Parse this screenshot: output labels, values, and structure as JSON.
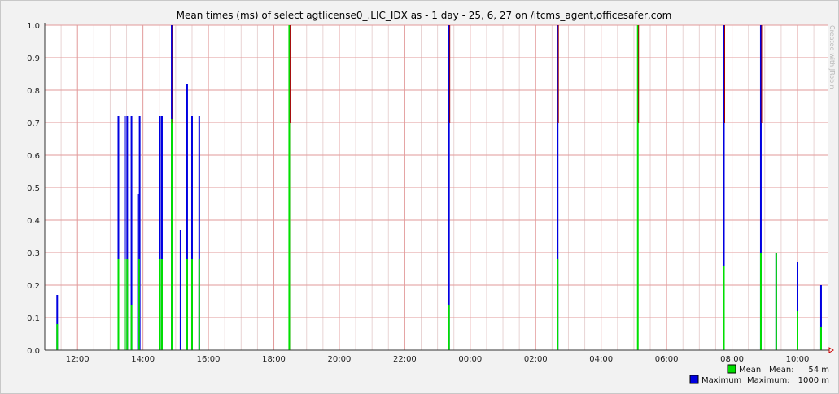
{
  "chart_data": {
    "type": "bar",
    "title": "Mean times (ms) of select agtlicense0_.LIC_IDX as - 1 day - 25, 6, 27 on /itcms_agent,officesafer,com",
    "watermark": "Created with JRobin",
    "x_ticks": [
      "12:00",
      "14:00",
      "16:00",
      "18:00",
      "20:00",
      "22:00",
      "00:00",
      "02:00",
      "04:00",
      "06:00",
      "08:00",
      "10:00"
    ],
    "x_range_hours": [
      11.0,
      22.6
    ],
    "x_tick_start_hour": 12,
    "y_ticks": [
      "0.0",
      "0.1",
      "0.2",
      "0.3",
      "0.4",
      "0.5",
      "0.6",
      "0.7",
      "0.8",
      "0.9",
      "1.0"
    ],
    "ylim": [
      0,
      1.0
    ],
    "grid": true,
    "series": [
      {
        "name": "Mean",
        "color": "#00e000",
        "stat_label": "Mean:",
        "stat_value": "54 m",
        "points": [
          {
            "h": 11.38,
            "v": 0.08
          },
          {
            "h": 13.25,
            "v": 0.28
          },
          {
            "h": 13.45,
            "v": 0.28
          },
          {
            "h": 13.52,
            "v": 0.28
          },
          {
            "h": 13.65,
            "v": 0.14
          },
          {
            "h": 13.88,
            "v": 0.28
          },
          {
            "h": 14.52,
            "v": 0.28
          },
          {
            "h": 14.58,
            "v": 0.28
          },
          {
            "h": 14.88,
            "v": 0.71
          },
          {
            "h": 15.35,
            "v": 0.28
          },
          {
            "h": 15.5,
            "v": 0.28
          },
          {
            "h": 15.72,
            "v": 0.28
          },
          {
            "h": 18.47,
            "v": 1.0
          },
          {
            "h": 23.35,
            "v": 0.14
          },
          {
            "h": 26.67,
            "v": 0.28
          },
          {
            "h": 29.12,
            "v": 1.0
          },
          {
            "h": 31.75,
            "v": 0.26
          },
          {
            "h": 32.88,
            "v": 0.3
          },
          {
            "h": 33.35,
            "v": 0.3
          },
          {
            "h": 34.0,
            "v": 0.12
          },
          {
            "h": 34.72,
            "v": 0.07
          }
        ]
      },
      {
        "name": "Maximum",
        "color": "#0000e0",
        "stat_label": "Maximum:",
        "stat_value": "1000 m",
        "points": [
          {
            "h": 11.38,
            "v": 0.17
          },
          {
            "h": 13.25,
            "v": 0.72
          },
          {
            "h": 13.45,
            "v": 0.72
          },
          {
            "h": 13.52,
            "v": 0.72
          },
          {
            "h": 13.65,
            "v": 0.72
          },
          {
            "h": 13.85,
            "v": 0.48
          },
          {
            "h": 13.9,
            "v": 0.72
          },
          {
            "h": 14.52,
            "v": 0.72
          },
          {
            "h": 14.58,
            "v": 0.72
          },
          {
            "h": 14.88,
            "v": 1.0
          },
          {
            "h": 15.15,
            "v": 0.37
          },
          {
            "h": 15.35,
            "v": 0.82
          },
          {
            "h": 15.5,
            "v": 0.72
          },
          {
            "h": 15.72,
            "v": 0.72
          },
          {
            "h": 23.35,
            "v": 1.0
          },
          {
            "h": 26.67,
            "v": 1.0
          },
          {
            "h": 31.75,
            "v": 1.0
          },
          {
            "h": 32.88,
            "v": 1.0
          },
          {
            "h": 33.35,
            "v": 0.3
          },
          {
            "h": 34.0,
            "v": 0.27
          },
          {
            "h": 34.72,
            "v": 0.2
          }
        ]
      }
    ]
  }
}
